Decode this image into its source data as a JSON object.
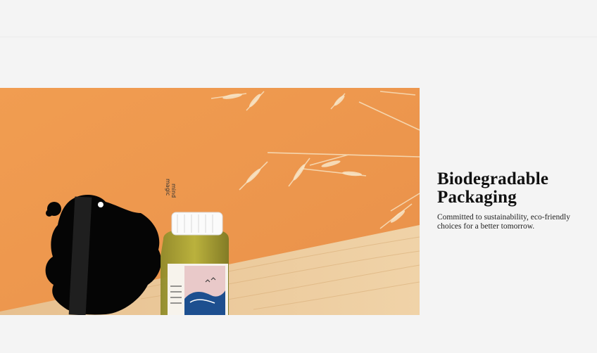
{
  "feature": {
    "title_line1": "Biodegradable",
    "title_line2": "Packaging",
    "description_line1": "Committed to sustainability, eco-friendly",
    "description_line2": "choices for a better tomorrow."
  },
  "product_label": {
    "brand_line1": "magic",
    "brand_line2": "mind"
  },
  "colors": {
    "page_background": "#f4f4f4",
    "wall_orange": "#ef9a4e",
    "wood": "#e9c79a",
    "title_text": "#111111"
  }
}
